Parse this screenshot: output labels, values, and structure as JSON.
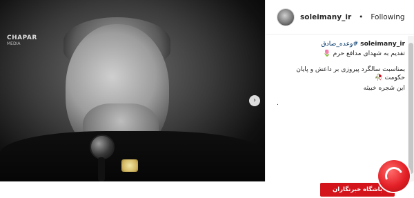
{
  "post": {
    "username": "soleimany_ir",
    "follow_separator": "•",
    "follow_label": "Following",
    "caption": {
      "user": "soleimany_ir",
      "hashtag": "#وعده_صادق",
      "line1": "تقدیم به شهدای مدافع حرم 🌷",
      "line2": "بمناسبت سالگرد پیروزی بر داعش و پایان حکومت 🥀",
      "line3": "این شجره خبیثه",
      "line4": "."
    }
  },
  "media": {
    "logo_line1": "CHAPAR",
    "logo_line2": "MEDIA"
  },
  "watermark": {
    "label": "باشگاه خبرنگاران"
  },
  "icons": {
    "next": "chevron-right-icon",
    "logo": "brand-logo-icon"
  }
}
